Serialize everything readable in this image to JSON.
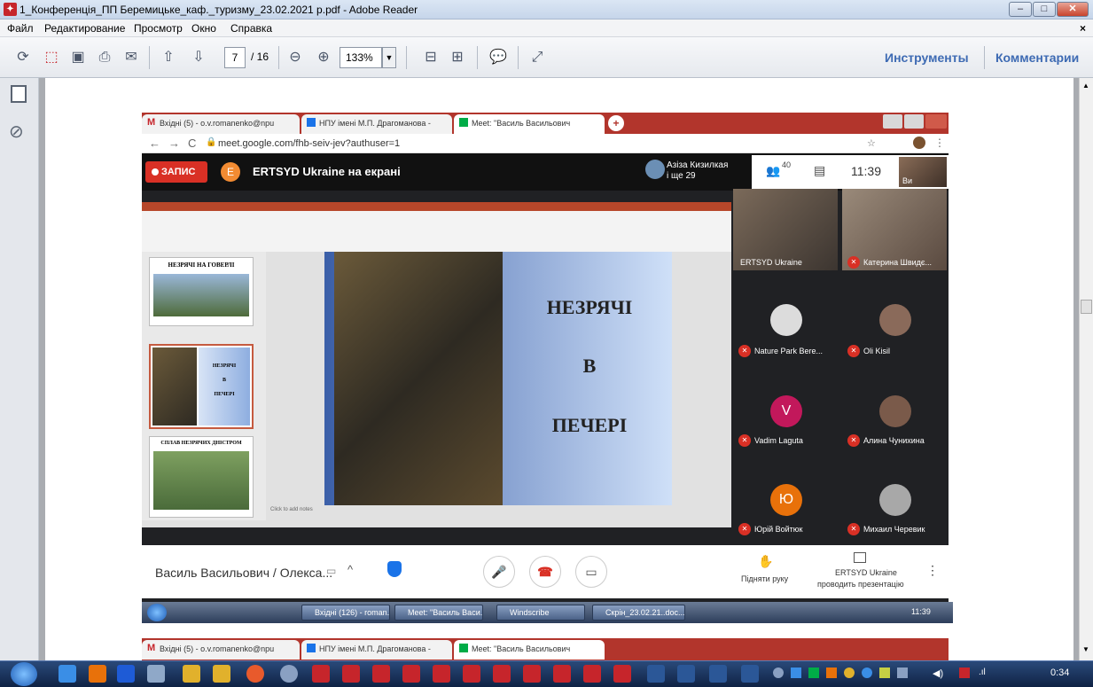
{
  "window": {
    "title": "1_Конференція_ПП Беремицьке_каф._туризму_23.02.2021 р.pdf - Adobe Reader",
    "min_label": "–",
    "max_label": "□",
    "close_label": "✕"
  },
  "menu": {
    "items": [
      "Файл",
      "Редактирование",
      "Просмотр",
      "Окно",
      "Справка"
    ],
    "close_doc": "×"
  },
  "toolbar": {
    "page_current": "7",
    "page_total": "/ 16",
    "zoom": "133%",
    "tools_label": "Инструменты",
    "comments_label": "Комментарии"
  },
  "browser": {
    "tabs": [
      {
        "label": "Вхідні (5) - o.v.romanenko@npu"
      },
      {
        "label": "НПУ імені М.П. Драгоманова -"
      },
      {
        "label": "Meet: \"Василь Васильович"
      }
    ],
    "url": "meet.google.com/fhb-seiv-jev?authuser=1",
    "new_tab": "+"
  },
  "meet": {
    "record_label": "ЗАПИС",
    "presenter_initial": "E",
    "presenting_text": "ERTSYD Ukraine на екрані",
    "pinned_user": "Азіза Кизилкая",
    "pinned_more": "і ще 29",
    "participants_count": "40",
    "time": "11:39",
    "self_label": "Ви",
    "meeting_name": "Василь Васильович / Олекса...",
    "raise_hand": "Підняти руку",
    "presenting_by": "ERTSYD Ukraine",
    "presenting_by_sub": "проводить презентацію",
    "participants": [
      {
        "name": "ERTSYD Ukraine"
      },
      {
        "name": "Катерина Швидє..."
      },
      {
        "name": "Nature Park Bere..."
      },
      {
        "name": "Oli Kisil"
      },
      {
        "name": "Vadim Laguta",
        "initial": "V"
      },
      {
        "name": "Алина Чунихина"
      },
      {
        "name": "Юрій Войтюк",
        "initial": "Ю"
      },
      {
        "name": "Михаил Черевик"
      }
    ]
  },
  "slide": {
    "line1": "НЕЗРЯЧІ",
    "line2": "В",
    "line3": "ПЕЧЕРІ",
    "thumb1": "НЕЗРЯЧІ НА ГОВЕРЛІ",
    "thumb2a": "НЕЗРЯЧІ",
    "thumb2b": "В",
    "thumb2c": "ПЕЧЕРІ",
    "thumb3": "СПЛАВ НЕЗРЯЧИХ ДНІСТРОМ",
    "notes": "Click to add notes"
  },
  "inner_taskbar": {
    "items": [
      "Вхідні (126) - roman...",
      "Meet: \"Василь Васи...",
      "Windscribe",
      "Скрін_23.02.21..doc..."
    ],
    "time": "11:39"
  },
  "tray": {
    "time": "0:34"
  }
}
